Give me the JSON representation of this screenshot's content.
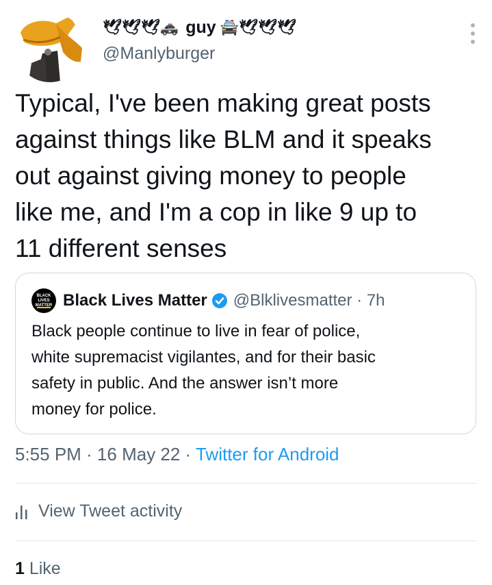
{
  "tweet": {
    "author": {
      "name_prefix_emoji": "🕊🕊🕊🚓",
      "name": "guy",
      "name_suffix_emoji": "🚔🕊🕊🕊",
      "handle": "@Manlyburger"
    },
    "text": "Typical, I've been making great posts\nagainst things like BLM and it speaks\nout against giving money to people\nlike me, and I'm a cop in like 9 up to\n11 different senses",
    "quoted": {
      "avatar_text_1": "BLACK",
      "avatar_text_2": "LIVES",
      "avatar_text_3": "MATTER",
      "name": "Black Lives Matter",
      "handle_time": "@Blklivesmatter · 7h",
      "text": "Black people continue to live in fear of police,\nwhite supremacist vigilantes, and for their basic\nsafety in public. And the answer isn’t more\nmoney for police."
    },
    "timestamp": "5:55 PM · 16 May 22 · ",
    "source": "Twitter for Android",
    "activity_label": "View Tweet activity",
    "like_count": "1",
    "like_label": " Like"
  },
  "colors": {
    "text": "#0f1419",
    "secondary": "#536471",
    "accent": "#1d9bf0",
    "divider": "#e1e8ed"
  },
  "icons": [
    "avatar-image",
    "more-options-icon",
    "verified-badge-icon",
    "activity-chart-icon"
  ]
}
